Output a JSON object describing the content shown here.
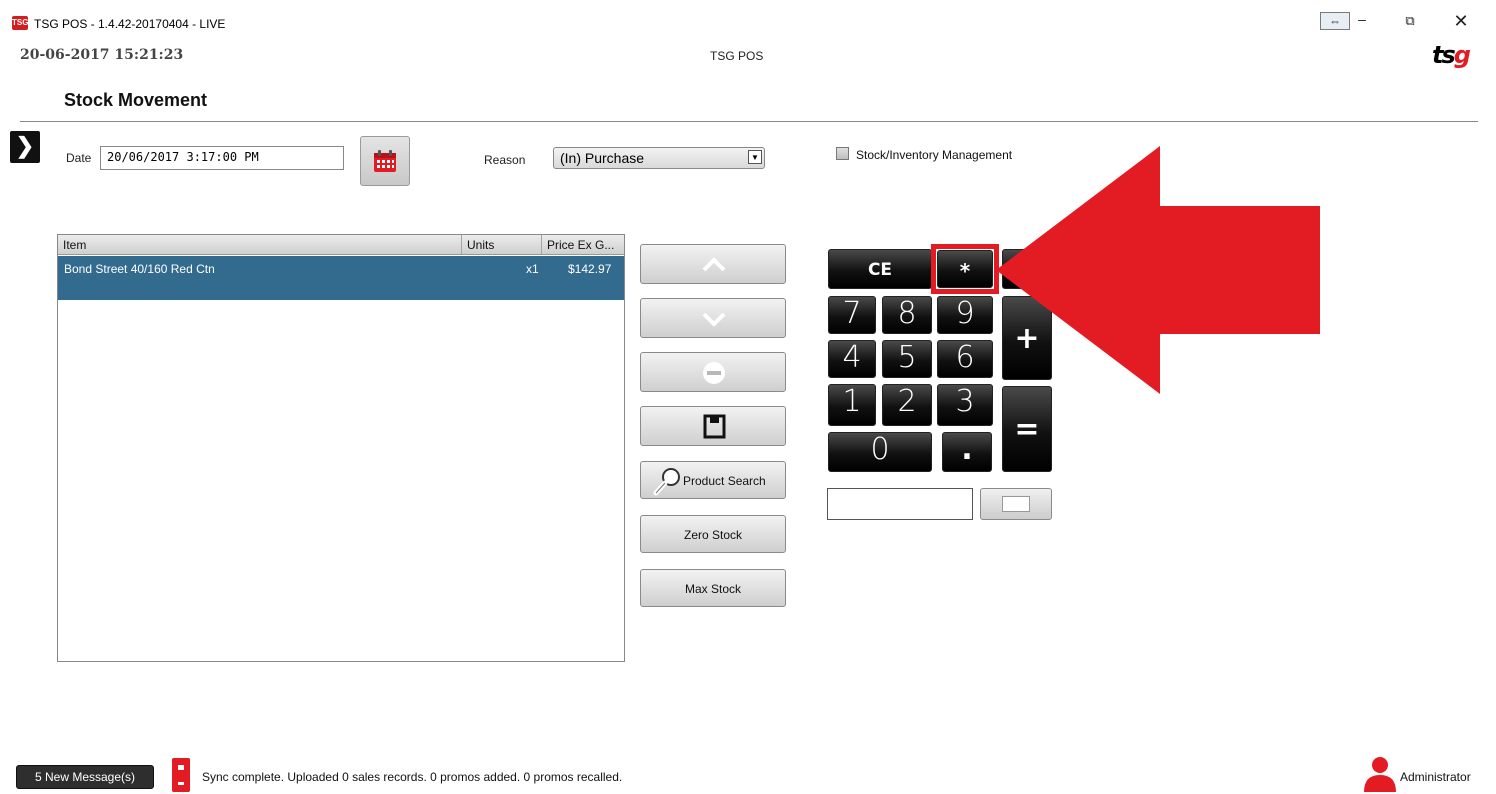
{
  "window": {
    "title": "TSG POS - 1.4.42-20170404 - LIVE",
    "icon_text": "TSG",
    "controls": {
      "resize": "⇔",
      "minimize": "–",
      "maximize": "⧉",
      "close": "✕"
    }
  },
  "header": {
    "datetime": "20-06-2017 15:21:23",
    "app_name": "TSG POS",
    "logo": {
      "main": "ts",
      "accent": "g"
    }
  },
  "page": {
    "title": "Stock Movement"
  },
  "form": {
    "date_label": "Date",
    "date_value": "20/06/2017 3:17:00 PM",
    "reason_label": "Reason",
    "reason_value": "(In) Purchase",
    "reason_arrow": "▼",
    "stock_management_label": "Stock/Inventory Management",
    "stock_management_checked": false
  },
  "table": {
    "columns": [
      "Item",
      "Units",
      "Price Ex G..."
    ],
    "rows": [
      {
        "item": "Bond Street 40/160 Red Ctn",
        "units": "x1",
        "price": "$142.97"
      }
    ]
  },
  "actions": {
    "product_search": "Product Search",
    "zero_stock": "Zero Stock",
    "max_stock": "Max Stock"
  },
  "keypad": {
    "ce": "CE",
    "multiply": "*",
    "digits": [
      "7",
      "8",
      "9",
      "4",
      "5",
      "6",
      "1",
      "2",
      "3",
      "0"
    ],
    "dot": ".",
    "plus": "+",
    "equals": "="
  },
  "status": {
    "messages": "5 New Message(s)",
    "sync": "Sync complete.  Uploaded 0 sales records. 0 promos added. 0 promos recalled.",
    "user": "Administrator"
  },
  "colors": {
    "accent_red": "#e31b23",
    "selected_row": "#336b8f"
  }
}
